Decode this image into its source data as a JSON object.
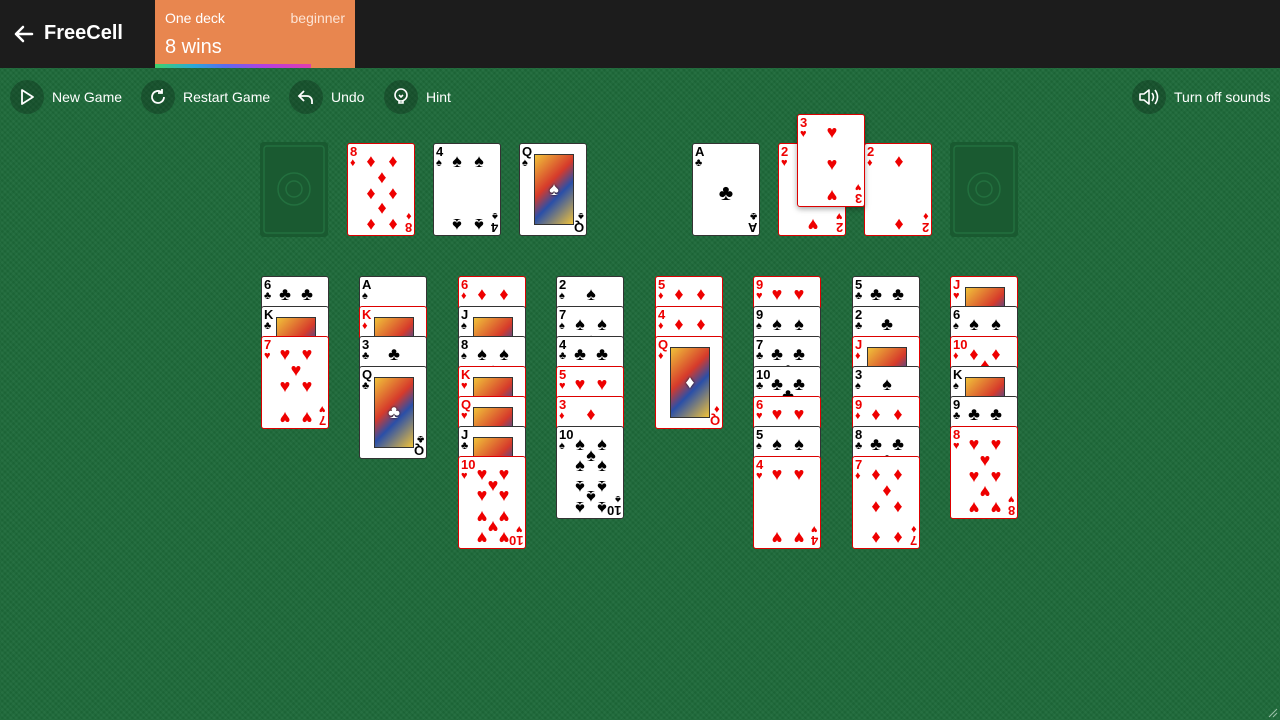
{
  "header": {
    "title": "FreeCell",
    "deck": "One deck",
    "level": "beginner",
    "wins": "8 wins",
    "progress": 0.78
  },
  "toolbar": {
    "new_game": "New Game",
    "restart": "Restart Game",
    "undo": "Undo",
    "hint": "Hint",
    "sounds": "Turn off sounds"
  },
  "freecells": [
    {
      "rank": "8",
      "suit": "♦",
      "color": "red"
    },
    {
      "rank": "4",
      "suit": "♠",
      "color": "black"
    },
    {
      "rank": "Q",
      "suit": "♠",
      "color": "black",
      "face": true
    }
  ],
  "foundations": [
    {
      "rank": "A",
      "suit": "♣",
      "color": "black"
    },
    {
      "rank": "2",
      "suit": "♥",
      "color": "red"
    },
    {
      "rank": "2",
      "suit": "♦",
      "color": "red"
    }
  ],
  "dragging_card": {
    "rank": "3",
    "suit": "♥",
    "color": "red"
  },
  "tableau": [
    [
      {
        "rank": "6",
        "suit": "♣"
      },
      {
        "rank": "K",
        "suit": "♣"
      },
      {
        "rank": "7",
        "suit": "♥"
      }
    ],
    [
      {
        "rank": "A",
        "suit": "♠"
      },
      {
        "rank": "K",
        "suit": "♦"
      },
      {
        "rank": "3",
        "suit": "♣"
      },
      {
        "rank": "Q",
        "suit": "♣"
      }
    ],
    [
      {
        "rank": "6",
        "suit": "♦"
      },
      {
        "rank": "J",
        "suit": "♠"
      },
      {
        "rank": "8",
        "suit": "♠"
      },
      {
        "rank": "K",
        "suit": "♥"
      },
      {
        "rank": "Q",
        "suit": "♥"
      },
      {
        "rank": "J",
        "suit": "♣"
      },
      {
        "rank": "10",
        "suit": "♥"
      }
    ],
    [
      {
        "rank": "2",
        "suit": "♠"
      },
      {
        "rank": "7",
        "suit": "♠"
      },
      {
        "rank": "4",
        "suit": "♣"
      },
      {
        "rank": "5",
        "suit": "♥"
      },
      {
        "rank": "3",
        "suit": "♦"
      },
      {
        "rank": "10",
        "suit": "♠"
      }
    ],
    [
      {
        "rank": "5",
        "suit": "♦"
      },
      {
        "rank": "4",
        "suit": "♦"
      },
      {
        "rank": "Q",
        "suit": "♦"
      }
    ],
    [
      {
        "rank": "9",
        "suit": "♥"
      },
      {
        "rank": "9",
        "suit": "♠"
      },
      {
        "rank": "7",
        "suit": "♣"
      },
      {
        "rank": "10",
        "suit": "♣"
      },
      {
        "rank": "6",
        "suit": "♥"
      },
      {
        "rank": "5",
        "suit": "♠"
      },
      {
        "rank": "4",
        "suit": "♥"
      }
    ],
    [
      {
        "rank": "5",
        "suit": "♣"
      },
      {
        "rank": "2",
        "suit": "♣"
      },
      {
        "rank": "J",
        "suit": "♦"
      },
      {
        "rank": "3",
        "suit": "♠"
      },
      {
        "rank": "9",
        "suit": "♦"
      },
      {
        "rank": "8",
        "suit": "♣"
      },
      {
        "rank": "7",
        "suit": "♦"
      }
    ],
    [
      {
        "rank": "J",
        "suit": "♥"
      },
      {
        "rank": "6",
        "suit": "♠"
      },
      {
        "rank": "10",
        "suit": "♦"
      },
      {
        "rank": "K",
        "suit": "♠"
      },
      {
        "rank": "9",
        "suit": "♣"
      },
      {
        "rank": "8",
        "suit": "♥"
      }
    ]
  ],
  "colors": {
    "felt": "#1e6a3a",
    "topbar": "#1c1c1c",
    "score_box": "#e8864f",
    "red_suit": "#e00000",
    "black_suit": "#000000"
  }
}
